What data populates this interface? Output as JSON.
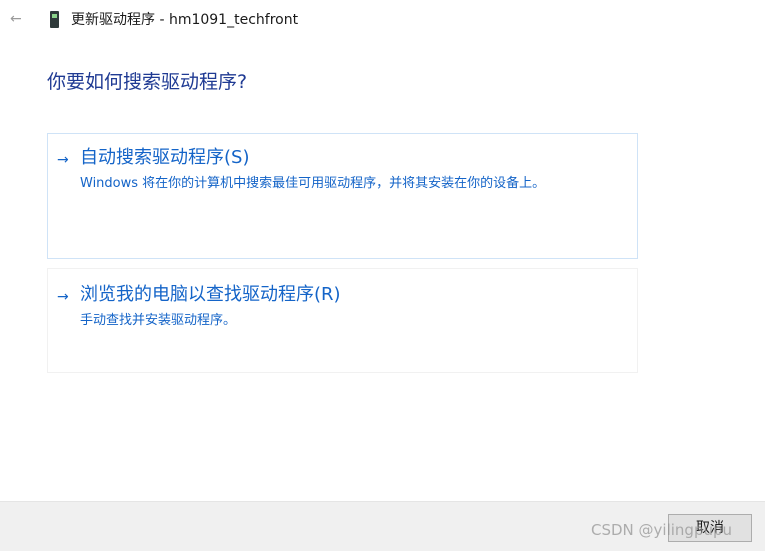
{
  "window": {
    "back_glyph": "←",
    "title": "更新驱动程序 - hm1091_techfront",
    "icon": "device-icon"
  },
  "main": {
    "heading": "你要如何搜索驱动程序?",
    "options": [
      {
        "arrow": "→",
        "title": "自动搜索驱动程序(S)",
        "description": "Windows 将在你的计算机中搜索最佳可用驱动程序，并将其安装在你的设备上。"
      },
      {
        "arrow": "→",
        "title": "浏览我的电脑以查找驱动程序(R)",
        "description": "手动查找并安装驱动程序。"
      }
    ]
  },
  "footer": {
    "cancel_label": "取消"
  },
  "watermark": {
    "text": "CSDN @yilingpupu"
  },
  "colors": {
    "accent": "#1464c8",
    "heading": "#1f3a93",
    "footer_bg": "#f0f0f0"
  }
}
